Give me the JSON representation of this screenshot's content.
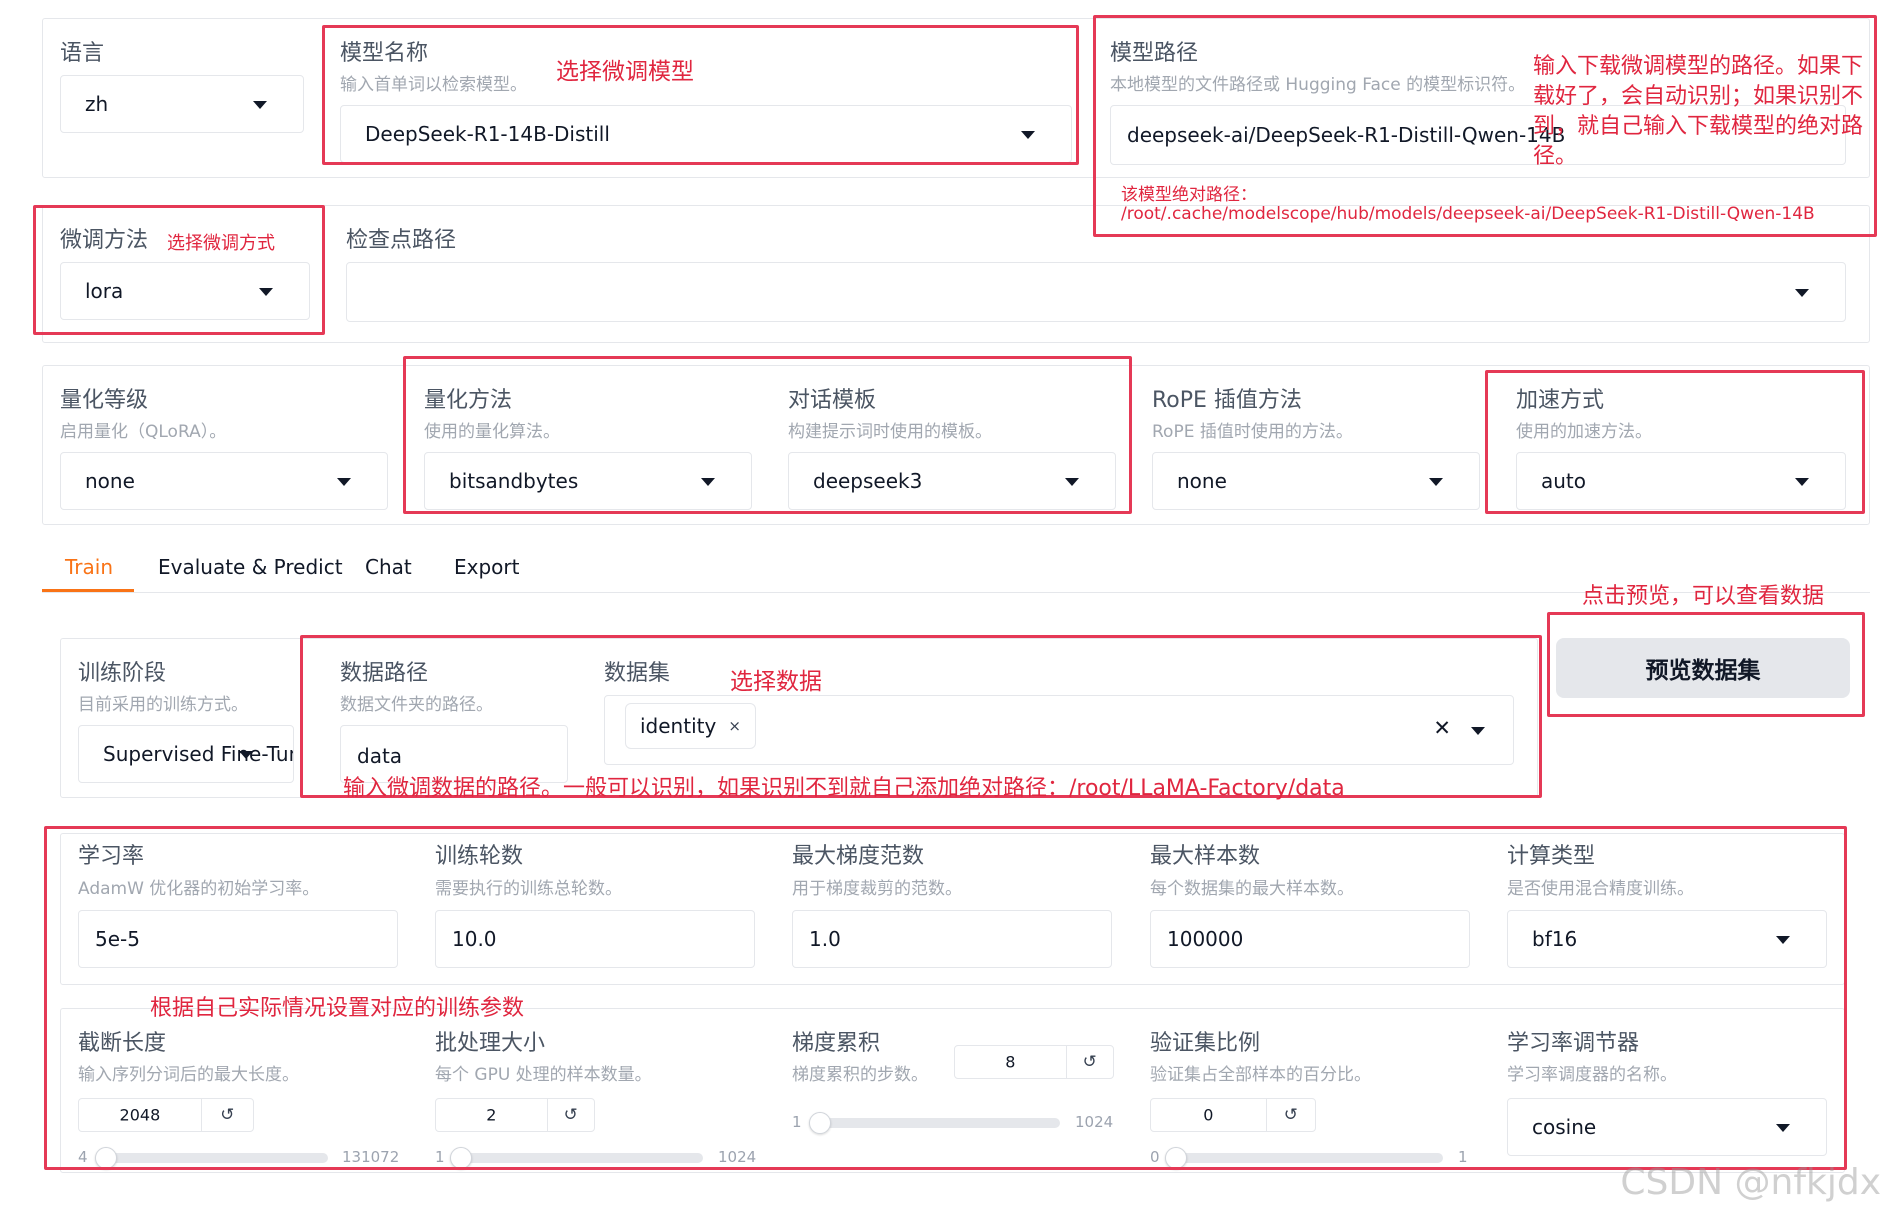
{
  "top": {
    "lang": {
      "label": "语言",
      "value": "zh"
    },
    "model_name": {
      "label": "模型名称",
      "info": "输入首单词以检索模型。",
      "value": "DeepSeek-R1-14B-Distill"
    },
    "model_path": {
      "label": "模型路径",
      "info": "本地模型的文件路径或 Hugging Face 的模型标识符。",
      "value": "deepseek-ai/DeepSeek-R1-Distill-Qwen-14B"
    },
    "finetune_method": {
      "label": "微调方法",
      "value": "lora"
    },
    "checkpoint": {
      "label": "检查点路径",
      "value": ""
    },
    "quant_bit": {
      "label": "量化等级",
      "info": "启用量化（QLoRA）。",
      "value": "none"
    },
    "quant_method": {
      "label": "量化方法",
      "info": "使用的量化算法。",
      "value": "bitsandbytes"
    },
    "template": {
      "label": "对话模板",
      "info": "构建提示词时使用的模板。",
      "value": "deepseek3"
    },
    "rope": {
      "label": "RoPE 插值方法",
      "info": "RoPE 插值时使用的方法。",
      "value": "none"
    },
    "booster": {
      "label": "加速方式",
      "info": "使用的加速方法。",
      "value": "auto"
    }
  },
  "tabs": [
    "Train",
    "Evaluate & Predict",
    "Chat",
    "Export"
  ],
  "train": {
    "stage": {
      "label": "训练阶段",
      "info": "目前采用的训练方式。",
      "value": "Supervised Fine-Tun"
    },
    "dataset_dir": {
      "label": "数据路径",
      "info": "数据文件夹的路径。",
      "value": "data"
    },
    "dataset": {
      "label": "数据集",
      "chip": "identity",
      "chip_close": "×",
      "clear": "✕"
    },
    "preview_button": "预览数据集",
    "learning_rate": {
      "label": "学习率",
      "info": "AdamW 优化器的初始学习率。",
      "value": "5e-5"
    },
    "epochs": {
      "label": "训练轮数",
      "info": "需要执行的训练总轮数。",
      "value": "10.0"
    },
    "max_grad_norm": {
      "label": "最大梯度范数",
      "info": "用于梯度裁剪的范数。",
      "value": "1.0"
    },
    "max_samples": {
      "label": "最大样本数",
      "info": "每个数据集的最大样本数。",
      "value": "100000"
    },
    "compute_type": {
      "label": "计算类型",
      "info": "是否使用混合精度训练。",
      "value": "bf16"
    },
    "cutoff_len": {
      "label": "截断长度",
      "info": "输入序列分词后的最大长度。",
      "value": "2048",
      "min": "4",
      "max": "131072",
      "fraction": 0.0156
    },
    "batch_size": {
      "label": "批处理大小",
      "info": "每个 GPU 处理的样本数量。",
      "value": "2",
      "min": "1",
      "max": "1024",
      "fraction": 0.001
    },
    "grad_accum": {
      "label": "梯度累积",
      "info": "梯度累积的步数。",
      "value": "8",
      "min": "1",
      "max": "1024",
      "fraction": 0.007
    },
    "val_size": {
      "label": "验证集比例",
      "info": "验证集占全部样本的百分比。",
      "value": "0",
      "min": "0",
      "max": "1",
      "fraction": 0
    },
    "lr_scheduler": {
      "label": "学习率调节器",
      "info": "学习率调度器的名称。",
      "value": "cosine"
    },
    "reset_glyph": "↺"
  },
  "annotations": {
    "select_model": "选择微调模型",
    "model_path_note": "输入下载微调模型的路径。如果下载好了，会自动识别；如果识别不到，就自己输入下载模型的绝对路径。",
    "abs_path_label": "该模型绝对路径：",
    "abs_path": "/root/.cache/modelscope/hub/models/deepseek-ai/DeepSeek-R1-Distill-Qwen-14B",
    "select_method": "选择微调方式",
    "preview_note": "点击预览，可以查看数据",
    "select_data": "选择数据",
    "data_path_note": "输入微调数据的路径。一般可以识别，如果识别不到就自己添加绝对路径：/root/LLaMA-Factory/data",
    "params_note": "根据自己实际情况设置对应的训练参数"
  },
  "watermark": "CSDN @nfkjdx",
  "colors": {
    "annotation_red": "#e53956",
    "tab_active": "#f97316"
  }
}
